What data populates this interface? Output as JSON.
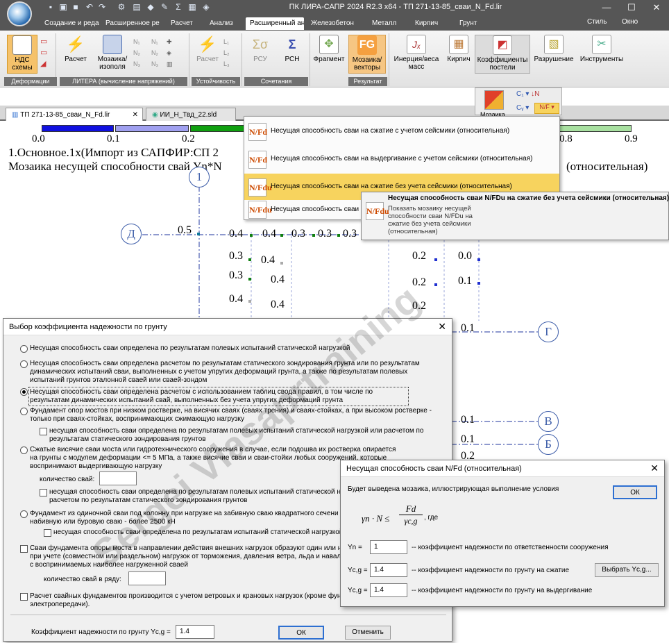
{
  "app": {
    "title": "ПК ЛИРА-САПР  2024 R2.3 x64 - ТП 271-13-85_сваи_N_Fd.lir",
    "style_label": "Стиль",
    "window_label": "Окно"
  },
  "ribbon_tabs": [
    "Создание и реда",
    "Расширенное ре",
    "Расчет",
    "Анализ",
    "Расширенный ан",
    "Железобетон",
    "Металл",
    "Кирпич",
    "Грунт"
  ],
  "ribbon": {
    "buttons": {
      "ndc": "НДС схемы",
      "raschet": "Расчет",
      "mosaic_iso": "Мозаика/ изополя",
      "raschet2": "Расчет",
      "rsu": "РСУ",
      "rsn": "РСН",
      "fragment": "Фрагмент",
      "mosaic_vec": "Мозаика/ векторы",
      "inertia": "Инерция/веса масс",
      "kirpich": "Кирпич",
      "coef": "Коэффициенты постели",
      "razrush": "Разрушение",
      "instr": "Инструменты",
      "sub_mosaic": "Мозаика"
    },
    "groups": [
      "Деформации",
      "ЛИТЕРА (вычисление напряжений)",
      "Устойчивость",
      "Сочетания",
      "Результат"
    ]
  },
  "doc_tabs": [
    "ТП 271-13-85_сваи_N_Fd.lir",
    "ИИ_Н_Твд_22.sld"
  ],
  "canvas": {
    "scale_ticks": [
      "0.0",
      "0.1",
      "0.2",
      "0.8",
      "0.9"
    ],
    "scale_colors": [
      "#1010e0",
      "#a0a0f0",
      "#10a010",
      "#60c060",
      "#a8e0a0"
    ],
    "line1": "1.Основное.1х(Импорт из САПФИР:СП 2",
    "line2": "Мозаика несущей способности свай Yn*N",
    "line2_right": "(относительная)",
    "axes": {
      "a1": "1",
      "d": "Д",
      "g": "Г",
      "v": "В",
      "b": "Б"
    },
    "values": {
      "v05": "0.5",
      "r1a": "0.4",
      "r1b": "0.4",
      "r1c": "0.3",
      "r1d": "0.3",
      "r1e": "0.3",
      "l1": "0.3",
      "l2": "0.4",
      "l3": "0.3",
      "l4": "0.4",
      "l5": "0.3",
      "l6": "0.4",
      "l7": "0.4",
      "m1": "0.2",
      "m2": "0.2",
      "m3": "0.2",
      "m4": "0.2",
      "n1": "0.0",
      "n2": "0.1",
      "n3": "0.1",
      "b1": "0.1",
      "b2": "0.1",
      "b3": "0.2"
    }
  },
  "menu": {
    "items": [
      {
        "icon": "N/Fd",
        "label": "Несущая способность сваи на сжатие с учетом сейсмики (относительная)"
      },
      {
        "icon": "N/Fd",
        "label": "Несущая способность сваи на выдергивание с учетом сейсмики (относительная)"
      },
      {
        "icon": "N/Fdu",
        "label": "Несущая способность сваи на сжатие без учета сейсмики (относительная)"
      },
      {
        "icon": "N/Fdu",
        "label": "Несущая способность сваи"
      }
    ],
    "tooltip_title": "Несущая способность сваи N/FDu  на сжатие без учета сейсмики (относительная)",
    "tooltip_icon": "N/Fdu",
    "tooltip_lines": [
      "Показать мозаику несущей",
      "способности сваи N/FDu  на",
      "сжатие без учета сейсмики",
      "(относительная)"
    ]
  },
  "dialog1": {
    "title": "Выбор коэффициента надежности по грунту",
    "opt1": "Несущая способность сваи определена по результатам полевых испытаний статической нагрузкой",
    "opt2": "Несущая способность сваи определена расчетом по результатам статического зондирования грунта или по результатам динамических испытаний сваи, выполненных с учетом упругих деформаций грунта, а также по результатам полевых испытаний грунтов эталонной сваей или сваей-зондом",
    "opt3": "Несущая способность сваи определена расчетом с использованием таблиц свода правил, в том числе по результатам динамических испытаний свай, выполненных без учета упругих деформаций грунта",
    "opt4": "Фундамент опор мостов при низком ростверке, на висячих сваях (сваях трения) и сваях-стойках, а при высоком ростверке - только при сваях-стойках, воспринимающих сжимающую нагрузку",
    "opt4_chk": "несущая способность сваи определена по результатам полевых испытаний статической нагрузкой или расчетом по результатам статического зондирования грунтов",
    "opt5": "Сжатые висячие сваи моста или гидротехнического сооружения в случае, если подошва их ростверка опирается на грунты с модулем деформации  <= 5 МПа, а также висячие сваи и сваи-стойки любых сооружений, которые воспринимают выдергивающую нагрузку",
    "opt5_count": "количество свай:",
    "opt5_chk": "несущая способность сваи определена по результатам полевых испытаний статической наг расчетом по результатам статического зондирования грунтов",
    "opt6": "Фундамент из одиночной сваи под колонну при нагрузке на забивную сваю квадратного сечени набивную или буровую сваю - более 2500 кН",
    "opt6_chk": "несущая способность сваи определена по результатам испытаний статической нагрузкой",
    "opt7": "Сваи фундамента опоры моста в направлении действия внешних нагрузок образуют один или нес при учете (совместном или раздельном) нагрузок от торможения, давления ветра, льда и навала с воспринимаемых наиболее нагруженной сваей",
    "opt7_count": "количество свай в ряду:",
    "opt8": "Расчет свайных фундаментов производится с учетом ветровых и крановых нагрузок (кроме фунда электропередачи).",
    "coef_label": "Коэффициент надежности по грунту Yc,g =",
    "coef_value": "1.4",
    "ok": "ОК",
    "cancel": "Отменить"
  },
  "dialog2": {
    "title": "Несущая способность сваи N/Fd (относительная)",
    "intro": "Будет выведена мозаика, иллюстрирующая выполнение условия",
    "formula_lhs": "γn · N ≤",
    "formula_num": "Fd",
    "formula_den": "γc,g",
    "formula_tail": ", где",
    "yn_label": "Yn  =",
    "yn_value": "1",
    "yn_desc": "-- коэффициент надежности по ответственности сооружения",
    "ycg1_label": "Yc,g =",
    "ycg1_value": "1.4",
    "ycg1_desc": "-- коэффициент надежности по грунту на сжатие",
    "ycg2_label": "Yc,g =",
    "ycg2_value": "1.4",
    "ycg2_desc": "-- коэффициент надежности по грунту на выдергивание",
    "ok": "ОК",
    "choose": "Выбрать Yc,g..."
  },
  "watermark": "Sergei Vlasaprtraining"
}
